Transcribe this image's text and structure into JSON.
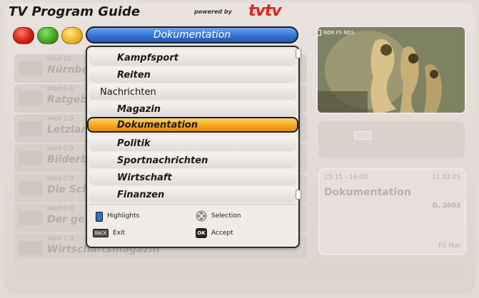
{
  "header": {
    "title": "TV Program Guide",
    "powered_by": "powered by",
    "brand": "tvtv"
  },
  "category_bar": {
    "label": "Dokumentation"
  },
  "color_keys": [
    "red",
    "green",
    "yellow"
  ],
  "background_list": [
    {
      "time": "Wed 22:",
      "name": "Nürnbe"
    },
    {
      "time": "Wed 0:4",
      "name": "Ratgeb"
    },
    {
      "time": "Wed 1:0",
      "name": "Letzlar"
    },
    {
      "time": "Wed 0:0",
      "name": "Bilderb"
    },
    {
      "time": "Wed 0:0",
      "name": "Die Sch"
    },
    {
      "time": "Wed 0:0",
      "name": "Der ge"
    },
    {
      "time": "Wed 1:0",
      "name": "Wirtschaftsmagazin"
    }
  ],
  "dropdown": {
    "items": [
      {
        "label": "Kampfsport",
        "level": "sub"
      },
      {
        "label": "Reiten",
        "level": "sub"
      },
      {
        "label": "Nachrichten",
        "level": "top"
      },
      {
        "label": "Magazin",
        "level": "sub"
      },
      {
        "label": "Dokumentation",
        "level": "sub",
        "selected": true
      },
      {
        "label": "Politik",
        "level": "sub"
      },
      {
        "label": "Sportnachrichten",
        "level": "sub"
      },
      {
        "label": "Wirtschaft",
        "level": "sub"
      },
      {
        "label": "Finanzen",
        "level": "sub"
      }
    ],
    "legend": {
      "highlights": "Highlights",
      "selection": "Selection",
      "exit": "Exit",
      "accept": "Accept",
      "back_key": "BACK",
      "ok_key": "OK"
    }
  },
  "preview": {
    "channel": "NDR FS NDS"
  },
  "info_box": {
    "time": "15:15 - 16:00",
    "date": "11.02.05",
    "title": "Dokumentation",
    "meta": "D, 2003",
    "channel": "FS Mar"
  },
  "colors": {
    "accent_blue": "#2f6fd1",
    "selected_orange": "#f3a31a",
    "brand_red": "#e02418"
  }
}
